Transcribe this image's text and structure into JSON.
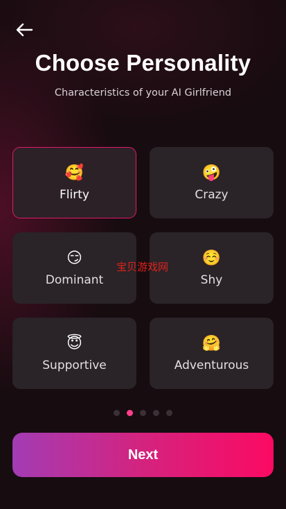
{
  "header": {
    "back_icon": "arrow-left-icon",
    "title": "Choose Personality",
    "subtitle": "Characteristics of your AI Girlfriend"
  },
  "personalities": [
    {
      "emoji": "🥰",
      "label": "Flirty",
      "selected": true
    },
    {
      "emoji": "🤪",
      "label": "Crazy",
      "selected": false
    },
    {
      "emoji": "😏",
      "label": "Dominant",
      "selected": false
    },
    {
      "emoji": "☺️",
      "label": "Shy",
      "selected": false
    },
    {
      "emoji": "😇",
      "label": "Supportive",
      "selected": false
    },
    {
      "emoji": "🤗",
      "label": "Adventurous",
      "selected": false
    }
  ],
  "watermark": "宝贝游戏网",
  "pagination": {
    "total": 5,
    "current": 2
  },
  "next_button": {
    "label": "Next"
  },
  "colors": {
    "accent": "#e2196b",
    "active_dot": "#ff3f8c",
    "button_gradient_start": "#a33cb4",
    "button_gradient_end": "#fb0a63",
    "card_bg": "#2a2328"
  }
}
